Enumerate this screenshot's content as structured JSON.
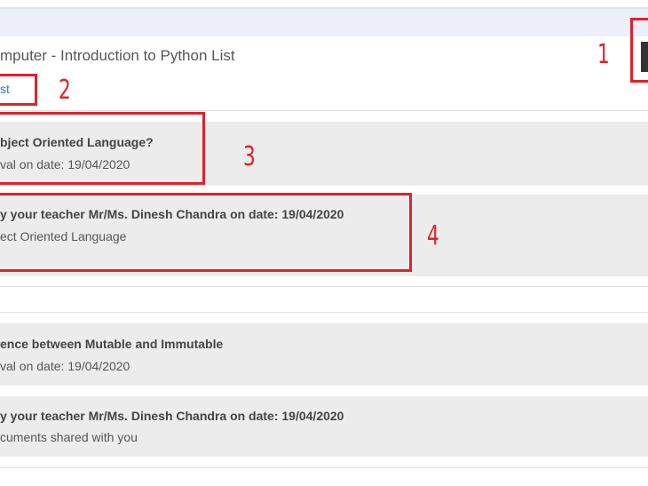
{
  "header": {
    "title": "mputer - Introduction to Python List",
    "link": "st"
  },
  "annotations": {
    "n1": "1",
    "n2": "2",
    "n3": "3",
    "n4": "4"
  },
  "messages": [
    {
      "title": "bject Oriented Language?",
      "subtitle": "val on date: 19/04/2020"
    },
    {
      "title": "y your teacher Mr/Ms. Dinesh Chandra on date: 19/04/2020",
      "subtitle": "ect Oriented Language"
    },
    {
      "title": "ence between Mutable and Immutable",
      "subtitle": "val on date: 19/04/2020"
    },
    {
      "title": "y your teacher Mr/Ms. Dinesh Chandra on date: 19/04/2020",
      "subtitle": "cuments shared with you"
    }
  ],
  "colors": {
    "annotation_red": "#e3202a",
    "link_blue": "#2f7fc1",
    "message_bg": "#ececec",
    "header_band": "#edf0f9"
  }
}
